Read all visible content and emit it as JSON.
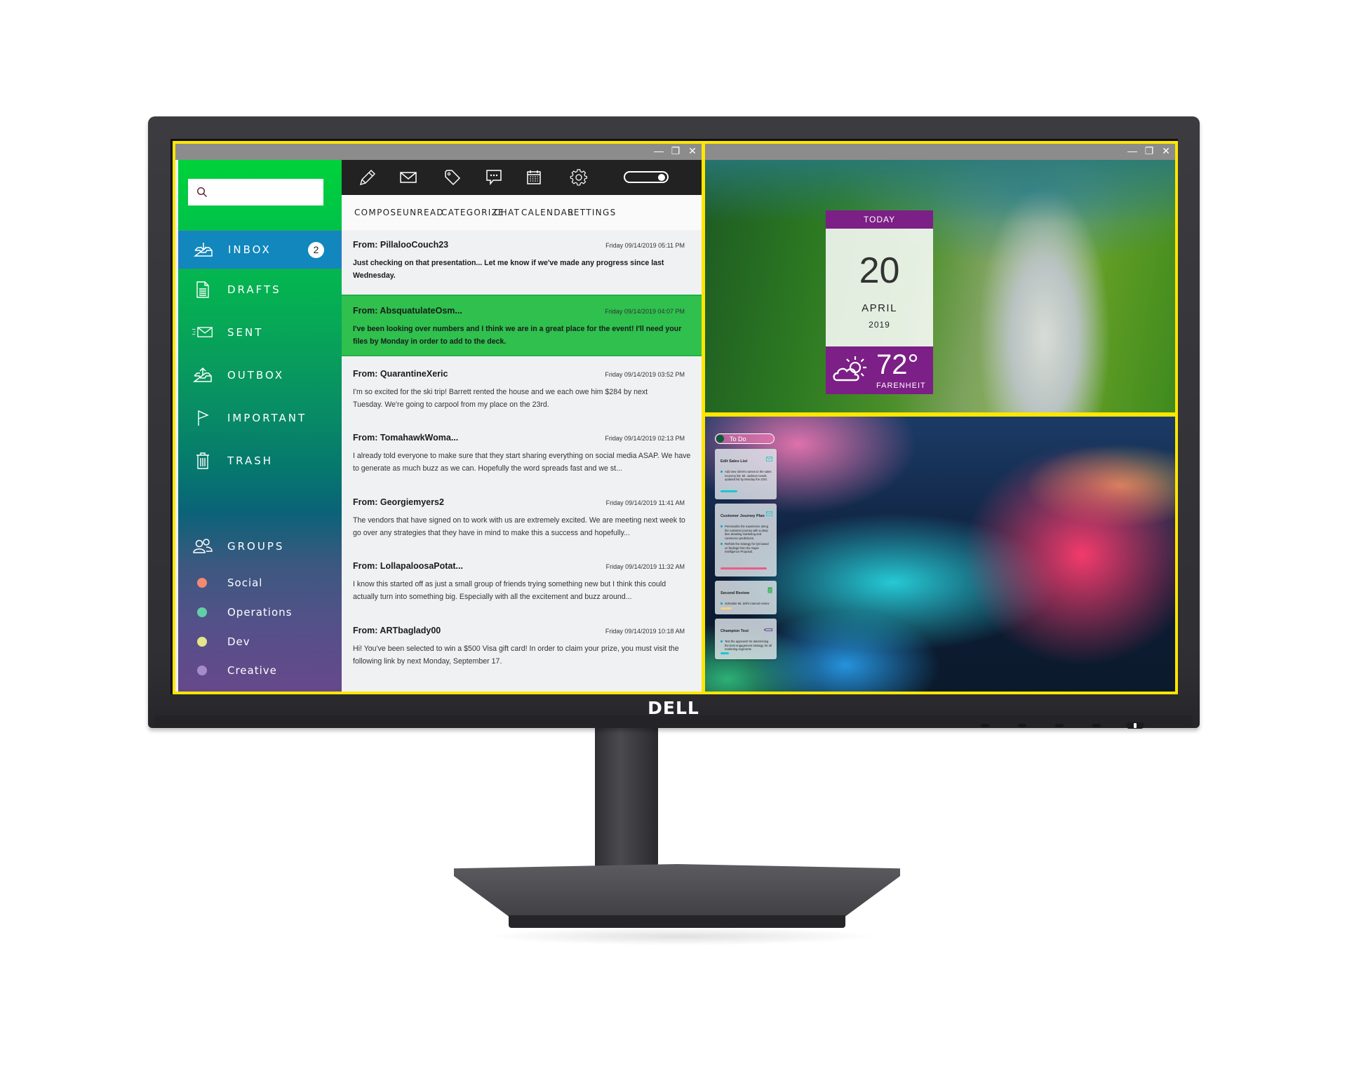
{
  "brand": {
    "logo_text": "DELL"
  },
  "mail_app": {
    "window_controls": {
      "minimize": "—",
      "restore": "❐",
      "close": "✕"
    },
    "search": {
      "placeholder": "",
      "icon": "search-icon"
    },
    "sidebar": {
      "items": [
        {
          "label": "INBOX",
          "icon": "inbox-download-icon",
          "badge": "2",
          "active": true
        },
        {
          "label": "DRAFTS",
          "icon": "document-icon"
        },
        {
          "label": "SENT",
          "icon": "sent-mail-icon"
        },
        {
          "label": "OUTBOX",
          "icon": "outbox-upload-icon"
        },
        {
          "label": "IMPORTANT",
          "icon": "flag-icon"
        },
        {
          "label": "TRASH",
          "icon": "trash-icon"
        }
      ],
      "groups_header": {
        "label": "GROUPS",
        "icon": "people-icon"
      },
      "groups": [
        {
          "label": "Social",
          "color": "#f28a72"
        },
        {
          "label": "Operations",
          "color": "#62d0a6"
        },
        {
          "label": "Dev",
          "color": "#e4e68a"
        },
        {
          "label": "Creative",
          "color": "#a78ac8"
        }
      ]
    },
    "toolbar": {
      "icons": [
        "pencil-icon",
        "envelope-icon",
        "tag-icon",
        "chat-bubble-icon",
        "calendar-icon",
        "gear-icon"
      ],
      "labels": [
        "COMPOSE",
        "UNREAD",
        "CATEGORIZE",
        "CHAT",
        "CALENDAR",
        "SETTINGS"
      ],
      "toggle_on": true
    },
    "messages": [
      {
        "from": "From: PillalooCouch23",
        "date": "Friday 09/14/2019 05:11 PM",
        "body": "Just checking on that presentation... Let me know if we've made any progress since last Wednesday.",
        "unread": true,
        "highlight": false
      },
      {
        "from": "From: AbsquatulateOsm...",
        "date": "Friday 09/14/2019 04:07 PM",
        "body": "I've been looking over numbers and I think we are in a great place for the event! I'll need your files by Monday in order to add to the deck.",
        "unread": true,
        "highlight": true
      },
      {
        "from": "From: QuarantineXeric",
        "date": "Friday 09/14/2019 03:52 PM",
        "body": "I'm so excited for the ski trip! Barrett rented the house and we each owe him $284 by next Tuesday. We're going to carpool from my place on the 23rd.",
        "unread": false,
        "highlight": false
      },
      {
        "from": "From: TomahawkWoma...",
        "date": "Friday 09/14/2019 02:13 PM",
        "body": "I already told everyone to make sure that they start sharing everything on social media ASAP. We have to generate as much buzz as we can. Hopefully the word spreads fast and we st...",
        "unread": false,
        "highlight": false
      },
      {
        "from": "From: Georgiemyers2",
        "date": "Friday 09/14/2019 11:41 AM",
        "body": "The vendors that have signed on to work with us are extremely excited. We are meeting next week to go over any strategies that they have in mind to make this a success and hopefully...",
        "unread": false,
        "highlight": false
      },
      {
        "from": "From: LollapaloosaPotat...",
        "date": "Friday 09/14/2019 11:32 AM",
        "body": "I know this started off as just a small group of friends trying something new but I think this could actually turn into something big. Especially with all the excitement and buzz around...",
        "unread": false,
        "highlight": false
      },
      {
        "from": "From: ARTbaglady00",
        "date": "Friday 09/14/2019 10:18 AM",
        "body": "Hi! You've been selected to win a $500 Visa gift card! In order to claim your prize, you must visit the following link by next Monday, September 17.",
        "unread": false,
        "highlight": false
      }
    ],
    "colors": {
      "sidebar_top": "#00d23a",
      "sidebar_bottom": "#66488b",
      "active_item": "#1187bd",
      "highlight_row": "#2fc04e",
      "toolbar_dark": "#222222"
    }
  },
  "photo_window": {
    "window_controls": {
      "minimize": "—",
      "restore": "❐",
      "close": "✕"
    },
    "date_widget": {
      "header": "TODAY",
      "day": "20",
      "month": "APRIL",
      "year": "2019",
      "temperature": "72°",
      "unit": "FARENHEIT",
      "weather_icon": "partly-cloudy-icon",
      "accent_color": "#7c1f86"
    }
  },
  "todo_window": {
    "pill_label": "To Do",
    "cards": [
      {
        "title": "Edit Sales List",
        "icon": "envelope-icon",
        "items": [
          "Add new client's names to the sales recovery list. Mr. Jackson needs updated list by Monday the 23rd."
        ],
        "bar_color": "#18c8d4"
      },
      {
        "title": "Customer Journey Plan",
        "icon": "envelope-icon",
        "items": [
          "Personalize the experience along the customer journey with a deep dive detailing marketing and commerce predictions.",
          "Rethink the strategy for Q4 based on findings from the Sayer Intelligence Proposal."
        ],
        "bar_color": "#f05a86"
      },
      {
        "title": "Second Review",
        "icon": "calendar-icon",
        "items": [
          "Schedule Mr. Zell's internal review"
        ],
        "bar_color": "#f8cf82"
      },
      {
        "title": "Champion Test",
        "icon": "pen-icon",
        "items": [
          "Test the approach for determining the best engagement strategy for all marketing segments"
        ],
        "bar_color": "#18c8d4"
      }
    ]
  }
}
